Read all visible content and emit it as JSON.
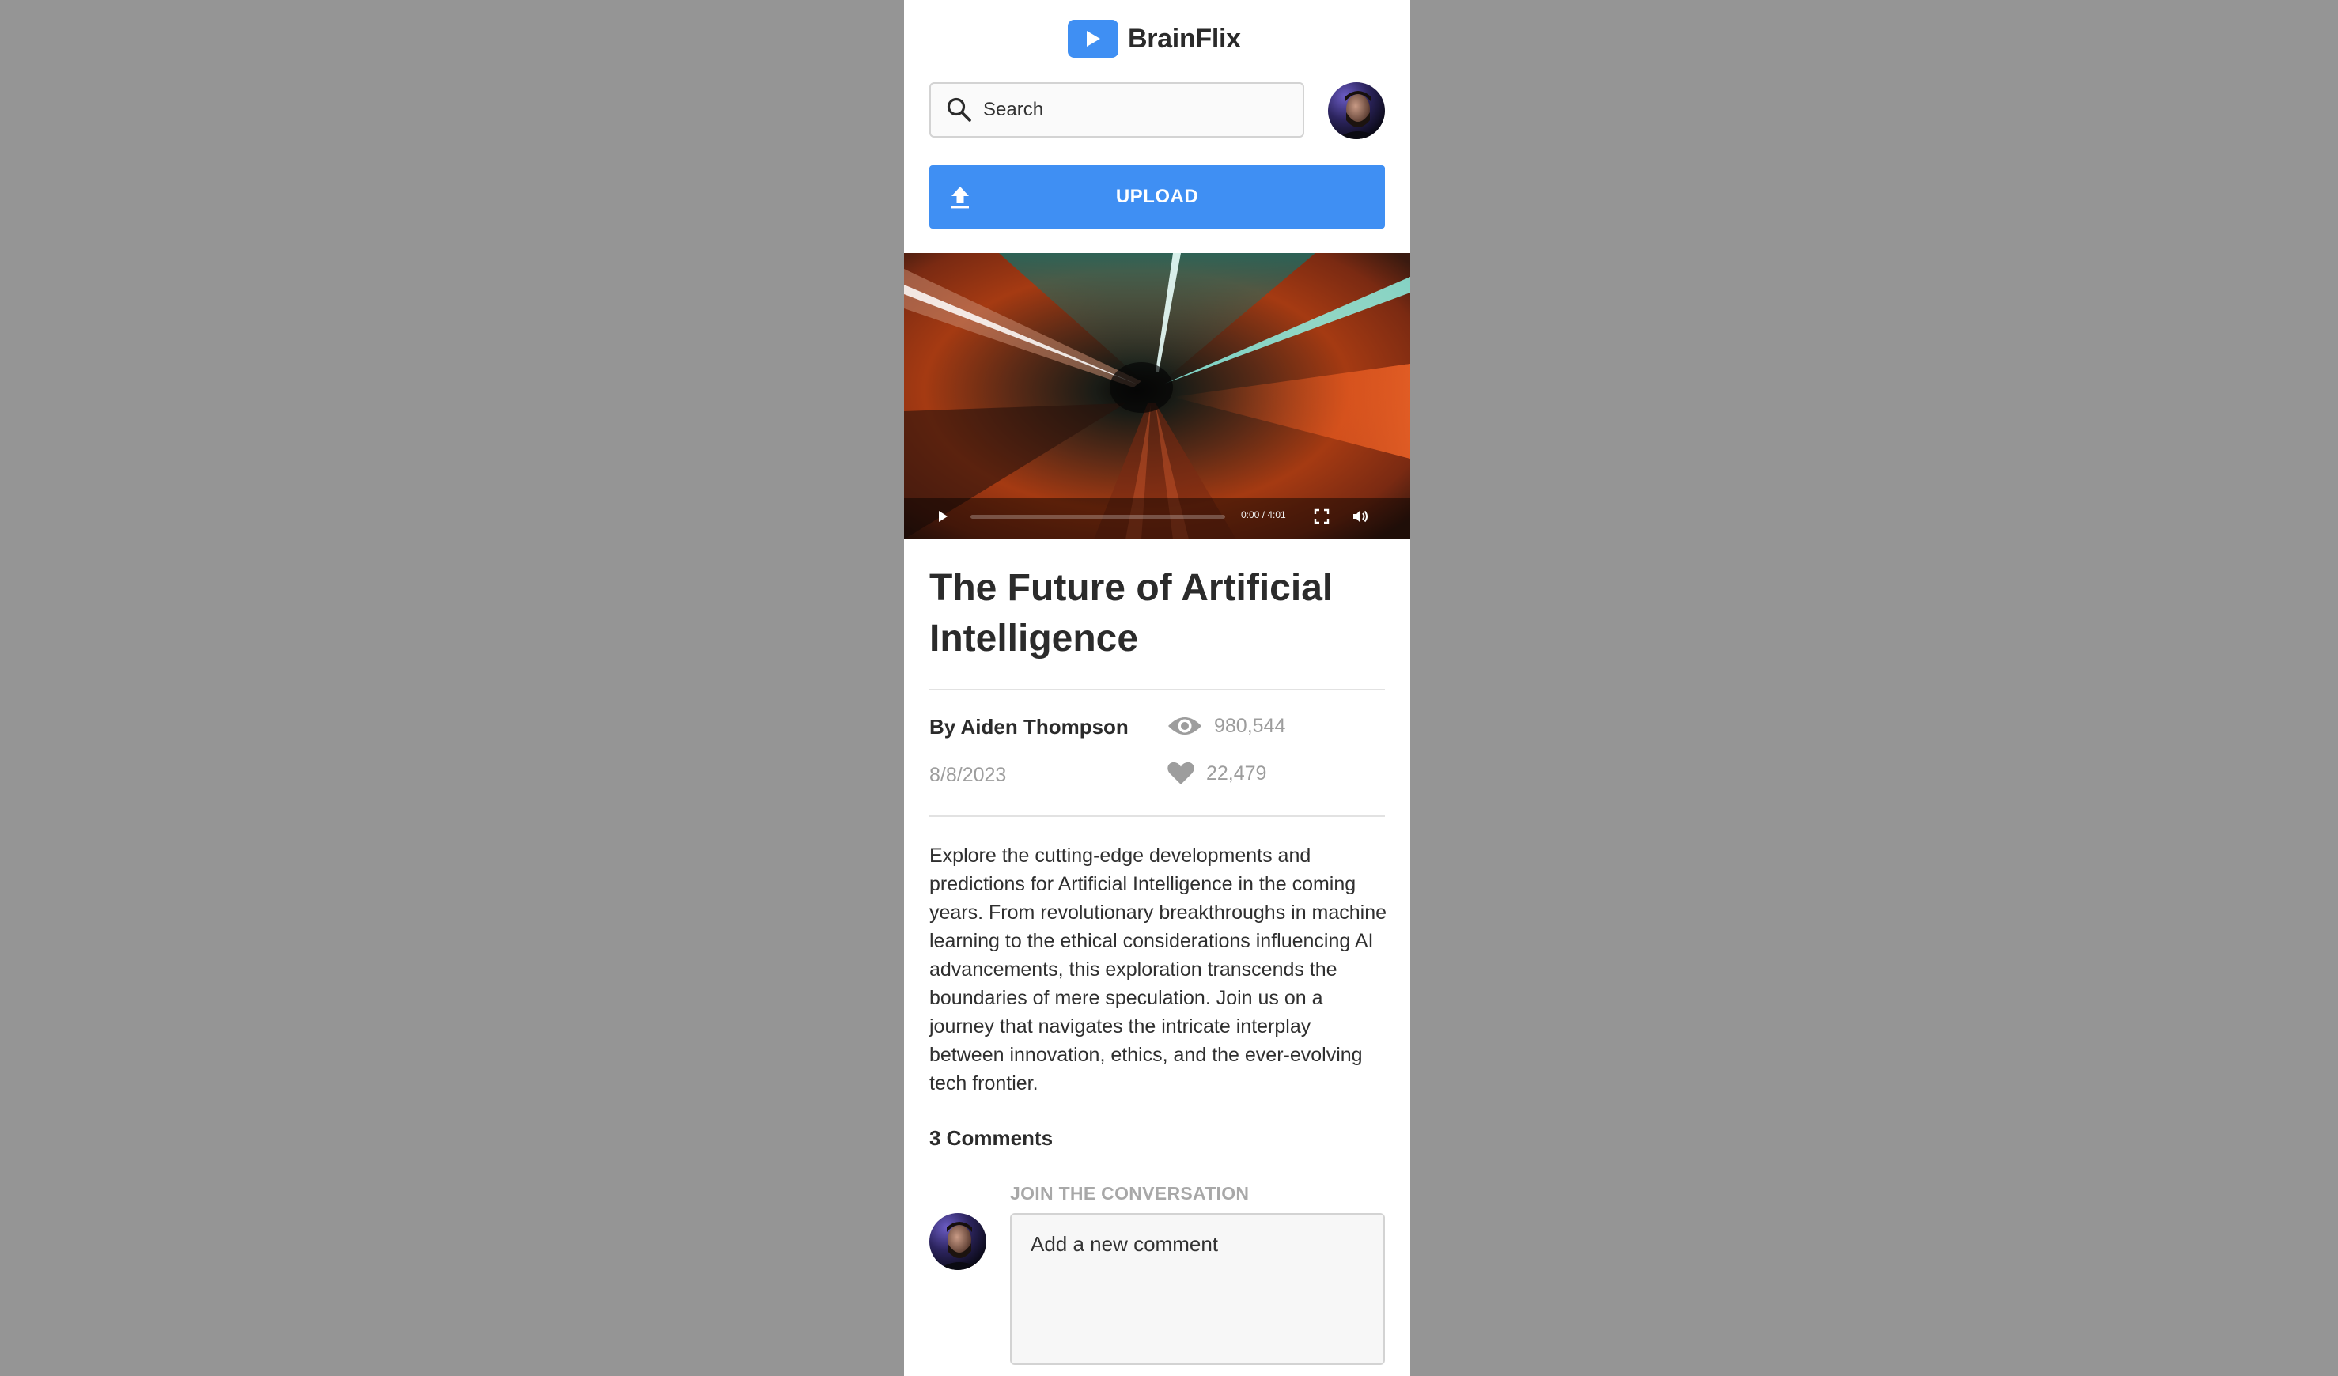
{
  "app": {
    "name": "BrainFlix"
  },
  "search": {
    "placeholder": "Search"
  },
  "upload": {
    "label": "UPLOAD"
  },
  "video": {
    "time": "0:00 / 4:01"
  },
  "details": {
    "title": "The Future of Artificial Intelligence",
    "author": "By Aiden Thompson",
    "date": "8/8/2023",
    "views": "980,544",
    "likes": "22,479",
    "description": "Explore the cutting-edge developments and predictions for Artificial Intelligence in the coming years. From revolutionary breakthroughs in machine learning to the ethical considerations influencing AI advancements, this exploration transcends the boundaries of mere speculation. Join us on a journey that navigates the intricate interplay between innovation, ethics, and the ever-evolving tech frontier."
  },
  "comments": {
    "count_label": "3 Comments",
    "join_label": "JOIN THE CONVERSATION",
    "input_placeholder": "Add a new comment"
  },
  "colors": {
    "accent": "#3f8ff3",
    "backdrop": "#959595",
    "muted_text": "#9d9d9d"
  },
  "icons": {
    "logo": "play-icon",
    "search": "search-icon",
    "upload": "upload-icon",
    "views": "eye-icon",
    "likes": "heart-icon",
    "play": "play-icon",
    "fullscreen": "fullscreen-icon",
    "volume": "volume-icon"
  }
}
